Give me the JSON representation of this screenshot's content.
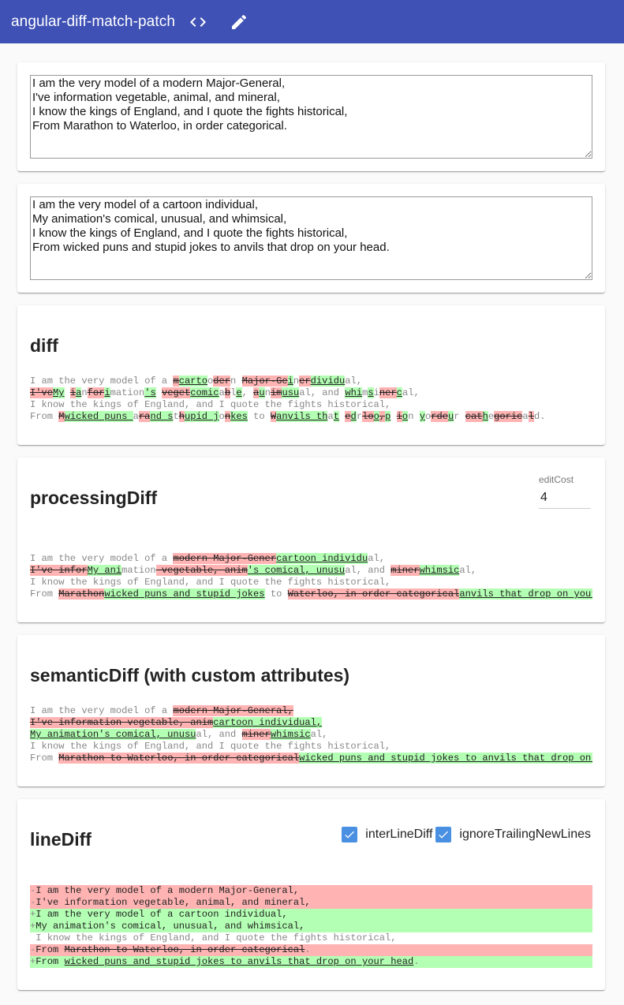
{
  "toolbar": {
    "title": "angular-diff-match-patch",
    "code_icon": "code-icon",
    "edit_icon": "pencil-icon",
    "color": "#3f51b5"
  },
  "inputs": {
    "left_text": "I am the very model of a modern Major-General,\nI've information vegetable, animal, and mineral,\nI know the kings of England, and I quote the fights historical,\nFrom Marathon to Waterloo, in order categorical.",
    "right_text": "I am the very model of a cartoon individual,\nMy animation's comical, unusual, and whimsical,\nI know the kings of England, and I quote the fights historical,\nFrom wicked puns and stupid jokes to anvils that drop on your head."
  },
  "colors": {
    "deletion": "#ffb3b3",
    "insertion": "#b3ffb3",
    "equal": "#888888"
  },
  "sections": {
    "diff": {
      "title": "diff",
      "lines": [
        [
          [
            "eq",
            "I am the very model of a "
          ],
          [
            "del",
            "m"
          ],
          [
            "ins",
            "carto"
          ],
          [
            "eq",
            "o"
          ],
          [
            "del",
            "der"
          ],
          [
            "eq",
            "n "
          ],
          [
            "del",
            "Major-Ge"
          ],
          [
            "ins",
            "i"
          ],
          [
            "eq",
            "n"
          ],
          [
            "del",
            "er"
          ],
          [
            "ins",
            "dividu"
          ],
          [
            "eq",
            "al,"
          ]
        ],
        [
          [
            "del",
            "I've"
          ],
          [
            "ins",
            "My"
          ],
          [
            "eq",
            " "
          ],
          [
            "del",
            "i"
          ],
          [
            "ins",
            "a"
          ],
          [
            "eq",
            "n"
          ],
          [
            "del",
            "for"
          ],
          [
            "ins",
            "i"
          ],
          [
            "eq",
            "mation"
          ],
          [
            "ins",
            "'s"
          ],
          [
            "eq",
            " "
          ],
          [
            "del",
            "veget"
          ],
          [
            "ins",
            "comic"
          ],
          [
            "eq",
            "a"
          ],
          [
            "del",
            "b"
          ],
          [
            "eq",
            "l"
          ],
          [
            "ins",
            "e"
          ],
          [
            "eq",
            ", "
          ],
          [
            "del",
            "a"
          ],
          [
            "ins",
            "u"
          ],
          [
            "eq",
            "n"
          ],
          [
            "del",
            "im"
          ],
          [
            "ins",
            "usu"
          ],
          [
            "eq",
            "al, and "
          ],
          [
            "ins",
            "whi"
          ],
          [
            "eq",
            "m"
          ],
          [
            "ins",
            "s"
          ],
          [
            "eq",
            "i"
          ],
          [
            "del",
            "ner"
          ],
          [
            "ins",
            "c"
          ],
          [
            "eq",
            "al,"
          ]
        ],
        [
          [
            "eq",
            "I know the kings of England, and I quote the fights historical,"
          ]
        ],
        [
          [
            "eq",
            "From "
          ],
          [
            "del",
            "M"
          ],
          [
            "ins",
            "wicked puns "
          ],
          [
            "eq",
            "a"
          ],
          [
            "del",
            "ra"
          ],
          [
            "ins",
            "nd s"
          ],
          [
            "eq",
            "t"
          ],
          [
            "del",
            "h"
          ],
          [
            "ins",
            "upid j"
          ],
          [
            "eq",
            "o"
          ],
          [
            "del",
            "n"
          ],
          [
            "ins",
            "kes"
          ],
          [
            "eq",
            " to "
          ],
          [
            "del",
            "W"
          ],
          [
            "ins",
            "anvils th"
          ],
          [
            "eq",
            "a"
          ],
          [
            "ins",
            "t"
          ],
          [
            "eq",
            " "
          ],
          [
            "del",
            "e"
          ],
          [
            "ins",
            "d"
          ],
          [
            "eq",
            "r"
          ],
          [
            "del",
            "lo"
          ],
          [
            "ins",
            "o"
          ],
          [
            "del",
            ","
          ],
          [
            "ins",
            "p"
          ],
          [
            "eq",
            " "
          ],
          [
            "del",
            "i"
          ],
          [
            "ins",
            "o"
          ],
          [
            "eq",
            "n "
          ],
          [
            "ins",
            "y"
          ],
          [
            "eq",
            "o"
          ],
          [
            "del",
            "rde"
          ],
          [
            "ins",
            "u"
          ],
          [
            "eq",
            "r "
          ],
          [
            "del",
            "cat"
          ],
          [
            "ins",
            "h"
          ],
          [
            "eq",
            "e"
          ],
          [
            "del",
            "goric"
          ],
          [
            "eq",
            "a"
          ],
          [
            "del",
            "l"
          ],
          [
            "eq",
            "d."
          ]
        ]
      ]
    },
    "processing": {
      "title": "processingDiff",
      "edit_cost_label": "editCost",
      "edit_cost_value": "4",
      "lines": [
        [
          [
            "eq",
            "I am the very model of a "
          ],
          [
            "del",
            "modern Major-Gener"
          ],
          [
            "ins",
            "cartoon individu"
          ],
          [
            "eq",
            "al,"
          ]
        ],
        [
          [
            "del",
            "I've infor"
          ],
          [
            "ins",
            "My ani"
          ],
          [
            "eq",
            "mation"
          ],
          [
            "del",
            " vegetable, anim"
          ],
          [
            "ins",
            "'s comical, unusu"
          ],
          [
            "eq",
            "al, and "
          ],
          [
            "del",
            "miner"
          ],
          [
            "ins",
            "whimsic"
          ],
          [
            "eq",
            "al,"
          ]
        ],
        [
          [
            "eq",
            "I know the kings of England, and I quote the fights historical,"
          ]
        ],
        [
          [
            "eq",
            "From "
          ],
          [
            "del",
            "Marathon"
          ],
          [
            "ins",
            "wicked puns and stupid jokes"
          ],
          [
            "eq",
            " to "
          ],
          [
            "del",
            "Waterloo, in order categorical"
          ],
          [
            "ins",
            "anvils that drop on your head"
          ],
          [
            "eq",
            "."
          ]
        ]
      ]
    },
    "semantic": {
      "title": "semanticDiff (with custom attributes)",
      "lines": [
        [
          [
            "eq",
            "I am the very model of a "
          ],
          [
            "del",
            "modern Major-General,"
          ]
        ],
        [
          [
            "del",
            "I've information vegetable, anim"
          ],
          [
            "ins",
            "cartoon individual,"
          ]
        ],
        [
          [
            "ins",
            "My animation's comical, unusu"
          ],
          [
            "eq",
            "al, and "
          ],
          [
            "del",
            "miner"
          ],
          [
            "ins",
            "whimsic"
          ],
          [
            "eq",
            "al,"
          ]
        ],
        [
          [
            "eq",
            "I know the kings of England, and I quote the fights historical,"
          ]
        ],
        [
          [
            "eq",
            "From "
          ],
          [
            "del",
            "Marathon to Waterloo, in order categorical"
          ],
          [
            "ins",
            "wicked puns and stupid jokes to anvils that drop on your head"
          ],
          [
            "eq",
            "."
          ]
        ]
      ]
    },
    "line": {
      "title": "lineDiff",
      "check1_label": "interLineDiff",
      "check2_label": "ignoreTrailingNewLines",
      "lines": [
        {
          "type": "del",
          "parts": [
            [
              "eq",
              "-"
            ],
            [
              "txt",
              "I am the very model of a modern Major-General,"
            ]
          ]
        },
        {
          "type": "del",
          "parts": [
            [
              "eq",
              "-"
            ],
            [
              "txt",
              "I've information vegetable, animal, and mineral,"
            ]
          ]
        },
        {
          "type": "ins",
          "parts": [
            [
              "eq",
              "+"
            ],
            [
              "txt",
              "I am the very model of a cartoon individual,"
            ]
          ]
        },
        {
          "type": "ins",
          "parts": [
            [
              "eq",
              "+"
            ],
            [
              "txt",
              "My animation's comical, unusual, and whimsical,"
            ]
          ]
        },
        {
          "type": "eq",
          "parts": [
            [
              "eq",
              " I know the kings of England, and I quote the fights historical,"
            ]
          ]
        },
        {
          "type": "del",
          "parts": [
            [
              "eq",
              "-"
            ],
            [
              "txt",
              "From "
            ],
            [
              "del",
              "Marathon to Waterloo, in order categorical"
            ],
            [
              "eq",
              "."
            ]
          ]
        },
        {
          "type": "ins",
          "parts": [
            [
              "eq",
              "+"
            ],
            [
              "txt",
              "From "
            ],
            [
              "ins",
              "wicked puns and stupid jokes to anvils that drop on your head"
            ],
            [
              "eq",
              "."
            ]
          ]
        }
      ]
    }
  }
}
